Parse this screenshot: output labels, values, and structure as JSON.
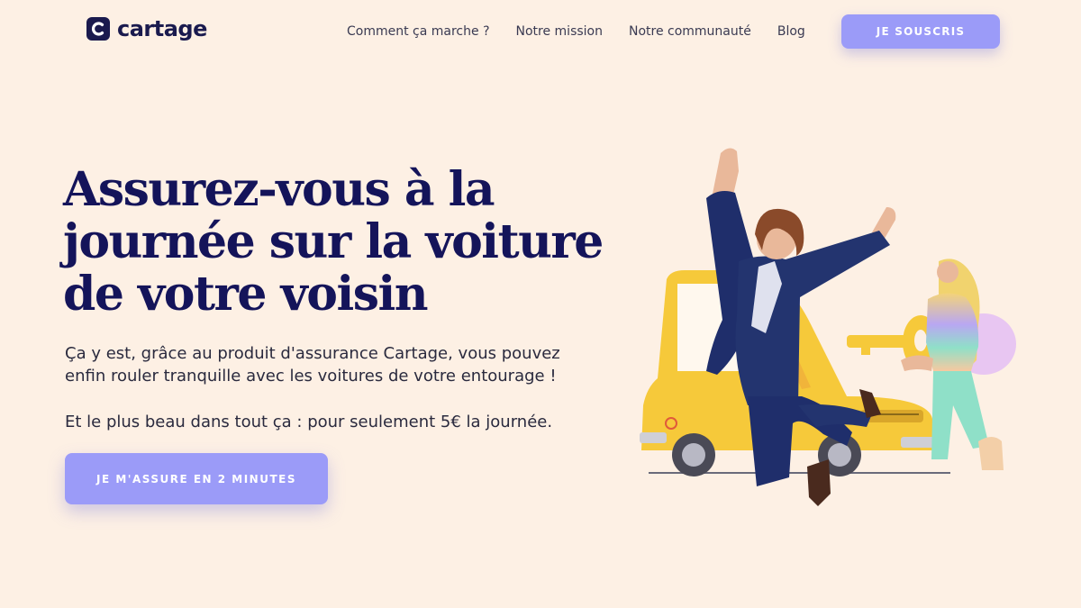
{
  "brand": {
    "name": "cartage",
    "color": "#1a1a4e"
  },
  "nav": {
    "links": [
      "Comment ça marche ?",
      "Notre mission",
      "Notre communauté",
      "Blog"
    ],
    "cta": "JE SOUSCRIS"
  },
  "hero": {
    "title": "Assurez-vous à la journée sur la voiture de votre voisin",
    "paragraph1": "Ça y est, grâce au produit d'assurance Cartage, vous pouvez enfin rouler tranquille avec les voitures de votre entourage !",
    "paragraph2": "Et le plus beau dans tout ça : pour seulement 5€ la journée.",
    "cta": "JE M'ASSURE EN 2 MINUTES"
  },
  "colors": {
    "background": "#fdf0e4",
    "accent": "#9b9bf8",
    "heading": "#14145a",
    "car": "#f6c93a"
  },
  "illustration": {
    "icons": [
      "jumping-woman-illustration",
      "yellow-car-illustration",
      "key-icon",
      "woman-with-key-illustration"
    ]
  }
}
